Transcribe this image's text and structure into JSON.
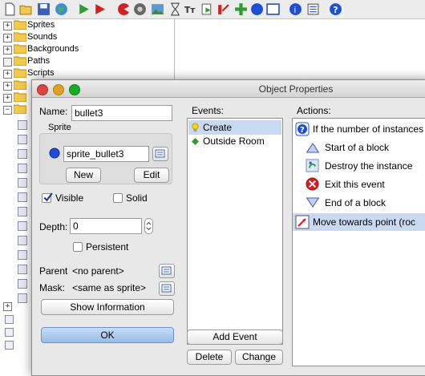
{
  "toolbar": {
    "icons": [
      "new-file-icon",
      "open-folder-icon",
      "save-icon",
      "globe-icon",
      "run-icon",
      "debug-run-icon",
      "sprite-icon",
      "sound-icon",
      "background-icon",
      "path-icon",
      "script-icon",
      "font-icon",
      "timeline-icon",
      "object-icon",
      "room-icon",
      "game-info-icon",
      "global-settings-icon",
      "help-icon"
    ]
  },
  "tree": {
    "folders": [
      "Sprites",
      "Sounds",
      "Backgrounds",
      "Paths",
      "Scripts"
    ]
  },
  "dialog": {
    "title": "Object Properties",
    "name_label": "Name:",
    "name_value": "bullet3",
    "sprite_group": "Sprite",
    "sprite_value": "sprite_bullet3",
    "new_label": "New",
    "edit_label": "Edit",
    "visible_label": "Visible",
    "visible_checked": true,
    "solid_label": "Solid",
    "solid_checked": false,
    "depth_label": "Depth:",
    "depth_value": "0",
    "persistent_label": "Persistent",
    "persistent_checked": false,
    "parent_label": "Parent",
    "parent_value": "<no parent>",
    "mask_label": "Mask:",
    "mask_value": "<same as sprite>",
    "show_info_label": "Show Information",
    "ok_label": "OK",
    "events_label": "Events:",
    "events": [
      {
        "label": "Create",
        "icon": "lightbulb-icon",
        "selected": true
      },
      {
        "label": "Outside Room",
        "icon": "green-diamond-icon",
        "selected": false
      }
    ],
    "add_event_label": "Add Event",
    "delete_label": "Delete",
    "change_label": "Change",
    "actions_label": "Actions:",
    "actions": [
      {
        "label": "If the number of instances",
        "icon": "question-instance-icon",
        "selected": false
      },
      {
        "label": "Start of a block",
        "icon": "triangle-up-icon",
        "selected": false
      },
      {
        "label": "Destroy the instance",
        "icon": "destroy-icon",
        "selected": false
      },
      {
        "label": "Exit this event",
        "icon": "exit-icon",
        "selected": false
      },
      {
        "label": "End of a block",
        "icon": "triangle-down-icon",
        "selected": false
      },
      {
        "label": "Move towards point (roc",
        "icon": "move-towards-icon",
        "selected": true
      }
    ]
  },
  "colors": {
    "selection": "#c9d9f2",
    "ok_button": "#a8c8ee",
    "close_light": "#e0443e",
    "min_light": "#dea123",
    "max_light": "#1aab29"
  }
}
